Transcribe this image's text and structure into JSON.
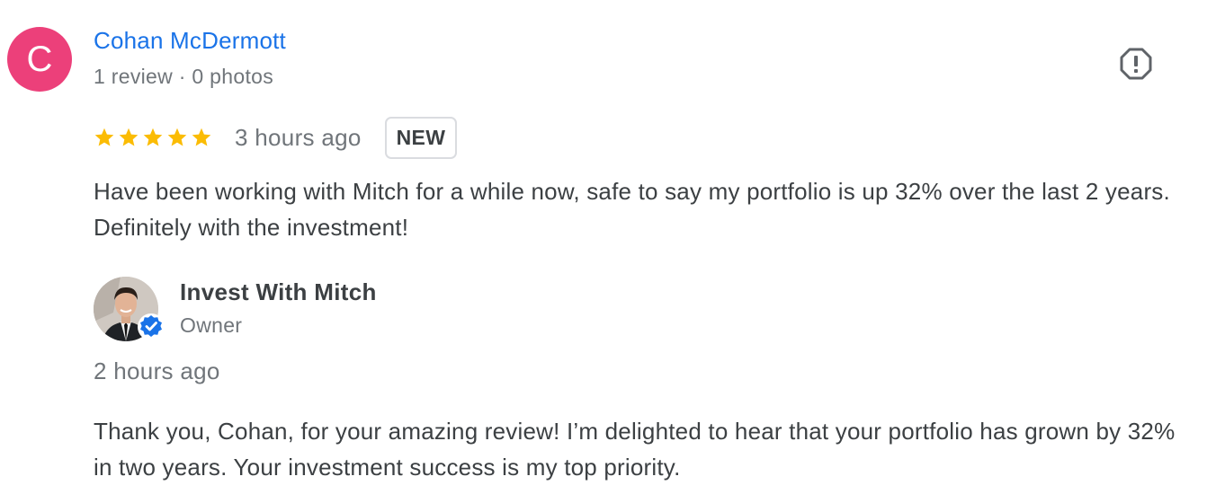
{
  "review": {
    "avatar_letter": "C",
    "avatar_color": "#ec407a",
    "reviewer_name": "Cohan McDermott",
    "reviewer_meta": "1 review · 0 photos",
    "rating": 5,
    "rating_max": 5,
    "star_color": "#fbbc04",
    "time": "3 hours ago",
    "badge": "NEW",
    "text": "Have been working with Mitch for a while now, safe to say my portfolio is up 32% over the last 2 years. Definitely with the investment!",
    "report_icon": "report-flag-icon"
  },
  "reply": {
    "owner_name": "Invest With Mitch",
    "owner_role": "Owner",
    "verified_icon": "verified-check-icon",
    "verified_color": "#1a73e8",
    "time": "2 hours ago",
    "text": "Thank you, Cohan, for your amazing review! I’m delighted to hear that your portfolio has grown by 32% in two years. Your investment success is my top priority."
  }
}
